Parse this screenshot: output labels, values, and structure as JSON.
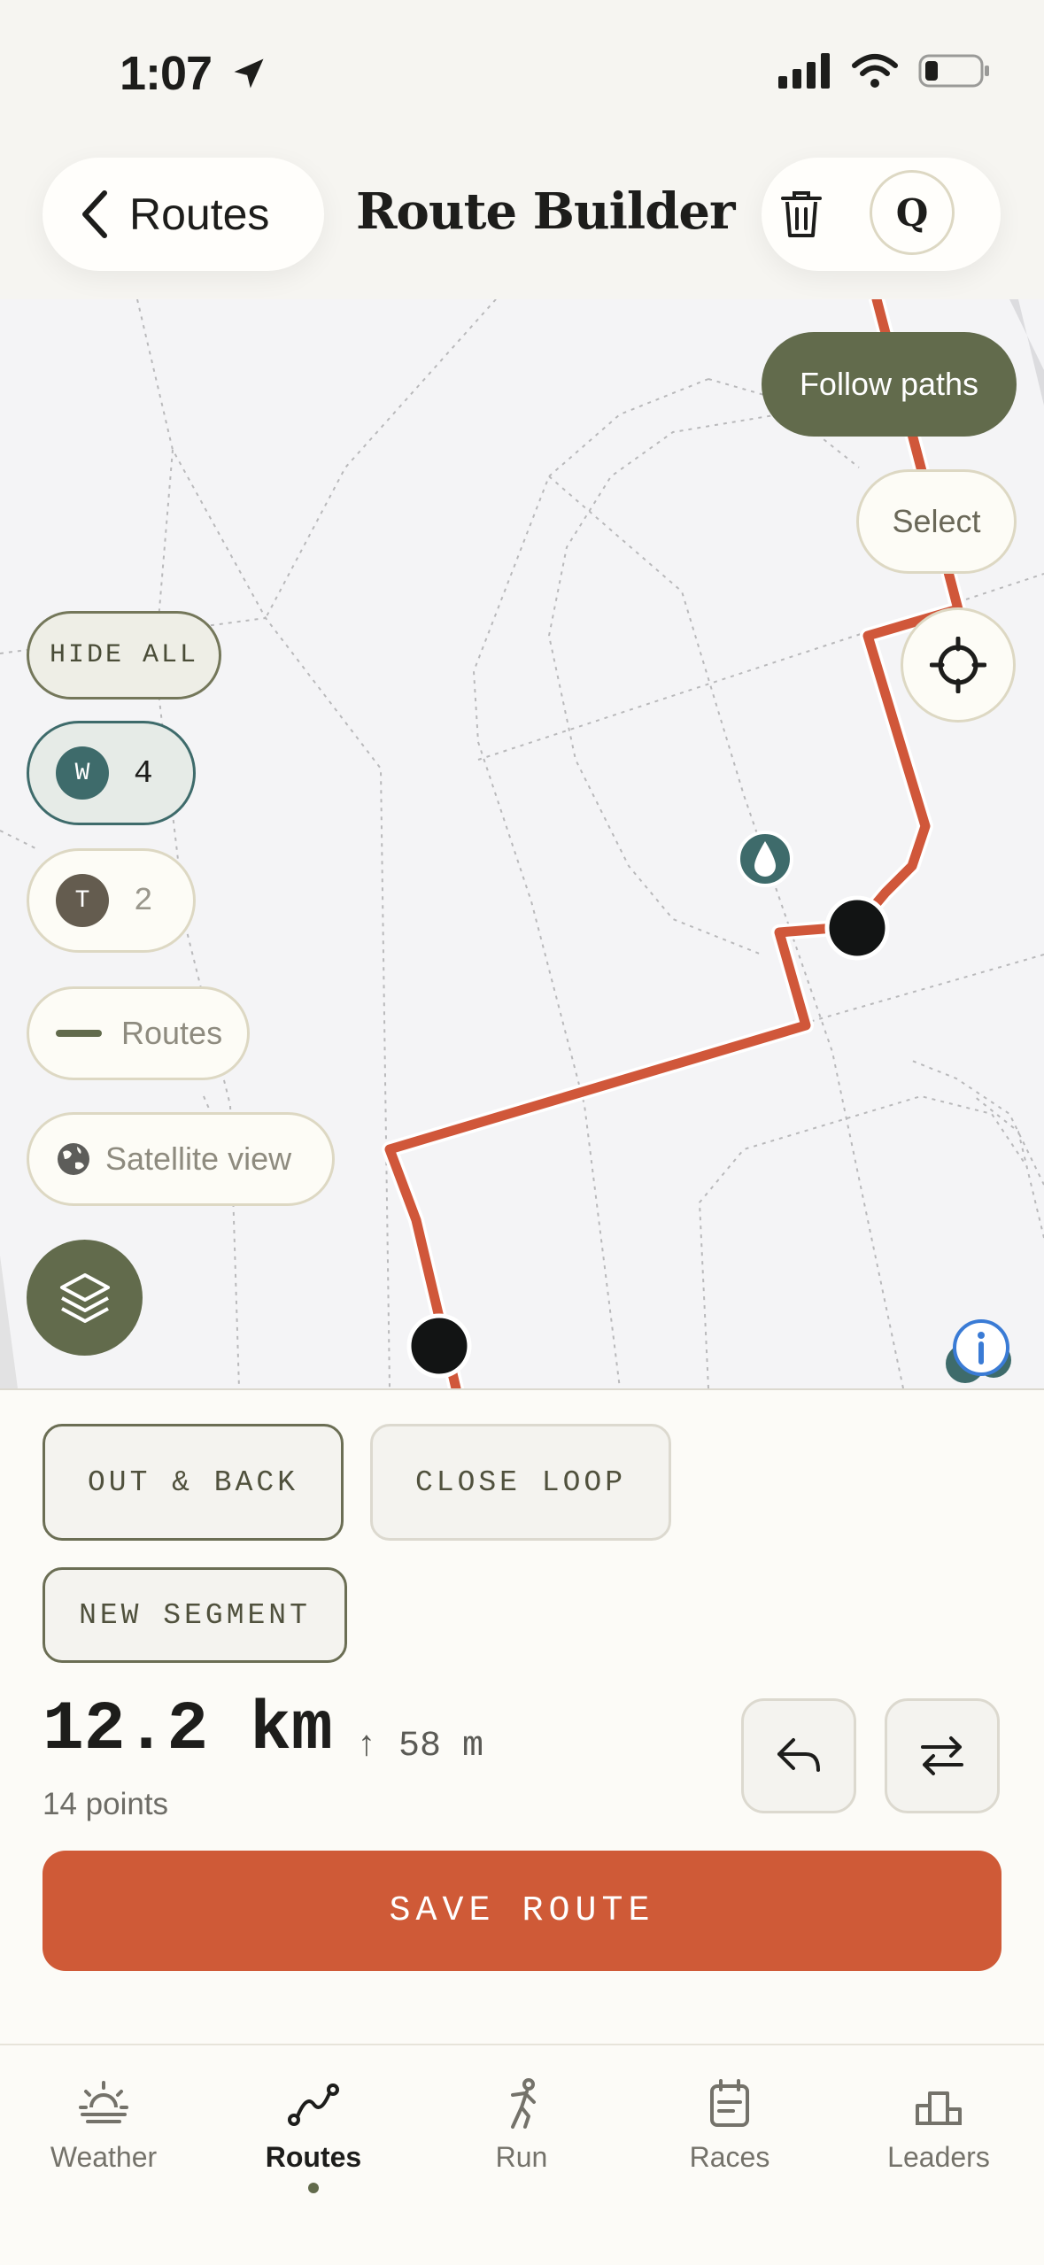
{
  "status_bar": {
    "time": "1:07"
  },
  "header": {
    "back_label": "Routes",
    "title": "Route Builder",
    "avatar_initial": "Q"
  },
  "map": {
    "follow_paths": "Follow paths",
    "select": "Select",
    "hide_all": "HIDE ALL",
    "waypoints": {
      "letter": "W",
      "count": "4"
    },
    "tracks": {
      "letter": "T",
      "count": "2"
    },
    "routes_toggle": "Routes",
    "satellite_view": "Satellite view",
    "colors": {
      "route": "#d0573a",
      "accent": "#626b4c",
      "waypoint": "#3e6b6b"
    },
    "icons": [
      "locate-icon",
      "layers-icon",
      "water-drop-icon",
      "info-icon",
      "globe-icon"
    ]
  },
  "sheet": {
    "out_and_back": "OUT & BACK",
    "close_loop": "CLOSE LOOP",
    "new_segment": "NEW SEGMENT",
    "distance": "12.2 km",
    "elevation": "↑ 58 m",
    "points": "14 points",
    "save": "SAVE ROUTE"
  },
  "tabs": [
    {
      "label": "Weather",
      "icon": "sunrise-icon"
    },
    {
      "label": "Routes",
      "icon": "route-icon",
      "active": true
    },
    {
      "label": "Run",
      "icon": "runner-icon"
    },
    {
      "label": "Races",
      "icon": "calendar-icon"
    },
    {
      "label": "Leaders",
      "icon": "podium-icon"
    }
  ]
}
